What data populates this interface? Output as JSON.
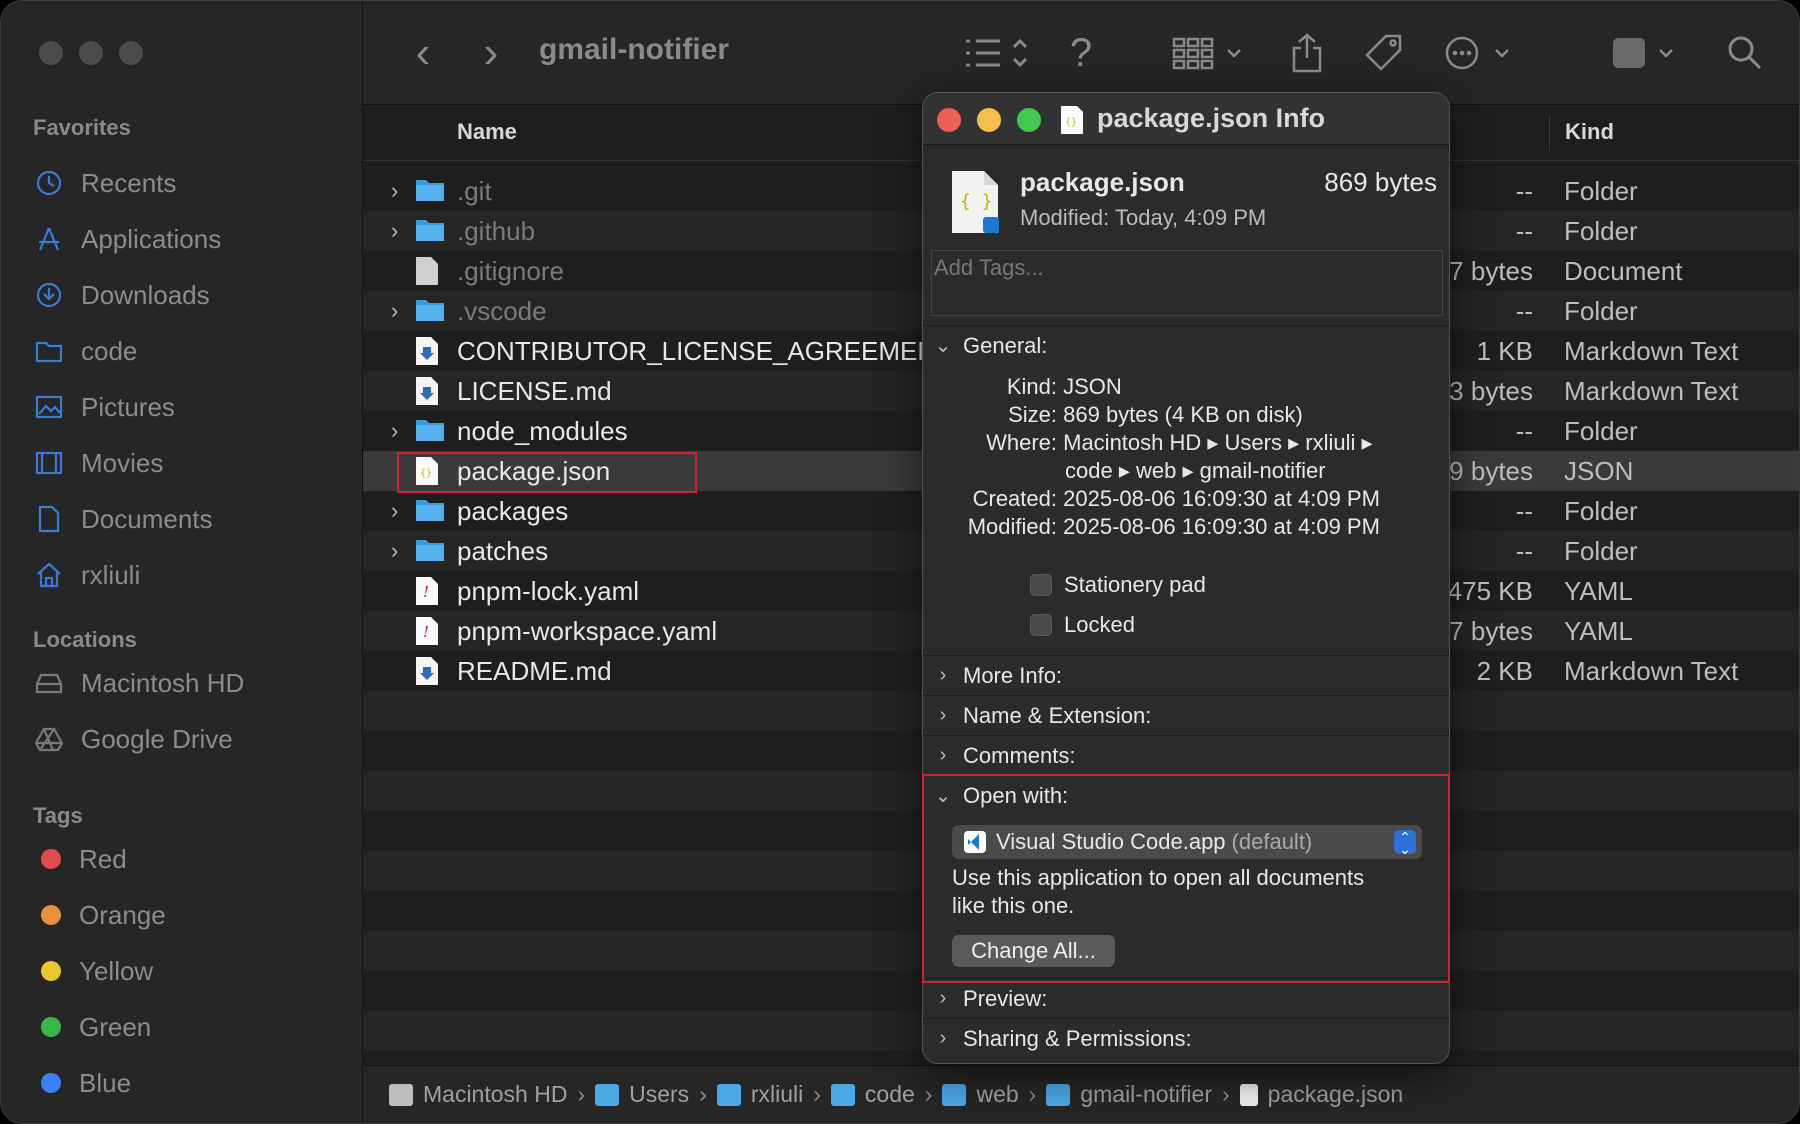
{
  "sidebar": {
    "favorites_header": "Favorites",
    "favorites": [
      {
        "label": "Recents",
        "icon": "clock-icon"
      },
      {
        "label": "Applications",
        "icon": "applications-icon"
      },
      {
        "label": "Downloads",
        "icon": "download-icon"
      },
      {
        "label": "code",
        "icon": "folder-icon"
      },
      {
        "label": "Pictures",
        "icon": "pictures-icon"
      },
      {
        "label": "Movies",
        "icon": "movies-icon"
      },
      {
        "label": "Documents",
        "icon": "document-icon"
      },
      {
        "label": "rxliuli",
        "icon": "home-icon"
      }
    ],
    "locations_header": "Locations",
    "locations": [
      {
        "label": "Macintosh HD",
        "icon": "disk-icon"
      },
      {
        "label": "Google Drive",
        "icon": "drive-icon"
      }
    ],
    "tags_header": "Tags",
    "tags": [
      {
        "label": "Red",
        "color": "#e04b4b"
      },
      {
        "label": "Orange",
        "color": "#e8913a"
      },
      {
        "label": "Yellow",
        "color": "#e8c92f"
      },
      {
        "label": "Green",
        "color": "#3ab54a"
      },
      {
        "label": "Blue",
        "color": "#3b82f6"
      }
    ]
  },
  "toolbar": {
    "title": "gmail-notifier",
    "back": "‹",
    "forward": "›",
    "help": "?"
  },
  "columns": {
    "name": "Name",
    "kind": "Kind"
  },
  "files": [
    {
      "name": ".git",
      "size": "--",
      "kind": "Folder",
      "type": "folder",
      "expandable": true,
      "hidden": true
    },
    {
      "name": ".github",
      "size": "--",
      "kind": "Folder",
      "type": "folder",
      "expandable": true,
      "hidden": true
    },
    {
      "name": ".gitignore",
      "size": "7 bytes",
      "kind": "Document",
      "type": "doc",
      "expandable": false,
      "hidden": true
    },
    {
      "name": ".vscode",
      "size": "--",
      "kind": "Folder",
      "type": "folder",
      "expandable": true,
      "hidden": true
    },
    {
      "name": "CONTRIBUTOR_LICENSE_AGREEMEN",
      "size": "1 KB",
      "kind": "Markdown Text",
      "type": "md",
      "expandable": false,
      "hidden": false
    },
    {
      "name": "LICENSE.md",
      "size": "3 bytes",
      "kind": "Markdown Text",
      "type": "md",
      "expandable": false,
      "hidden": false
    },
    {
      "name": "node_modules",
      "size": "--",
      "kind": "Folder",
      "type": "folder",
      "expandable": true,
      "hidden": false
    },
    {
      "name": "package.json",
      "size": "9 bytes",
      "kind": "JSON",
      "type": "json",
      "expandable": false,
      "hidden": false,
      "selected": true
    },
    {
      "name": "packages",
      "size": "--",
      "kind": "Folder",
      "type": "folder",
      "expandable": true,
      "hidden": false
    },
    {
      "name": "patches",
      "size": "--",
      "kind": "Folder",
      "type": "folder",
      "expandable": true,
      "hidden": false
    },
    {
      "name": "pnpm-lock.yaml",
      "size": "475 KB",
      "kind": "YAML",
      "type": "yaml",
      "expandable": false,
      "hidden": false
    },
    {
      "name": "pnpm-workspace.yaml",
      "size": "7 bytes",
      "kind": "YAML",
      "type": "yaml",
      "expandable": false,
      "hidden": false
    },
    {
      "name": "README.md",
      "size": "2 KB",
      "kind": "Markdown Text",
      "type": "md",
      "expandable": false,
      "hidden": false
    }
  ],
  "pathbar": [
    {
      "label": "Macintosh HD",
      "icon": "disk-icon"
    },
    {
      "label": "Users",
      "icon": "folder-icon"
    },
    {
      "label": "rxliuli",
      "icon": "folder-icon"
    },
    {
      "label": "code",
      "icon": "folder-icon"
    },
    {
      "label": "web",
      "icon": "folder-icon"
    },
    {
      "label": "gmail-notifier",
      "icon": "folder-icon"
    },
    {
      "label": "package.json",
      "icon": "json-file-icon"
    }
  ],
  "info": {
    "window_title": "package.json Info",
    "file_name": "package.json",
    "file_size": "869 bytes",
    "modified_short": "Modified:  Today, 4:09 PM",
    "tags_placeholder": "Add Tags...",
    "general_header": "General:",
    "general": {
      "kind_label": "Kind:",
      "kind": "JSON",
      "size_label": "Size:",
      "size": "869 bytes (4 KB on disk)",
      "where_label": "Where:",
      "where_line1": "Macintosh HD ▸ Users ▸ rxliuli ▸",
      "where_line2": "code ▸ web ▸ gmail-notifier",
      "created_label": "Created:",
      "created": "2025-08-06 16:09:30 at 4:09 PM",
      "modified_label": "Modified:",
      "modified": "2025-08-06 16:09:30 at 4:09 PM"
    },
    "stationery_label": "Stationery pad",
    "locked_label": "Locked",
    "more_info": "More Info:",
    "name_ext": "Name & Extension:",
    "comments": "Comments:",
    "open_with_header": "Open with:",
    "open_with_app": "Visual Studio Code.app",
    "open_with_default": "(default)",
    "open_with_note_1": "Use this application to open all documents",
    "open_with_note_2": "like this one.",
    "change_all": "Change All...",
    "preview": "Preview:",
    "sharing": "Sharing & Permissions:"
  }
}
